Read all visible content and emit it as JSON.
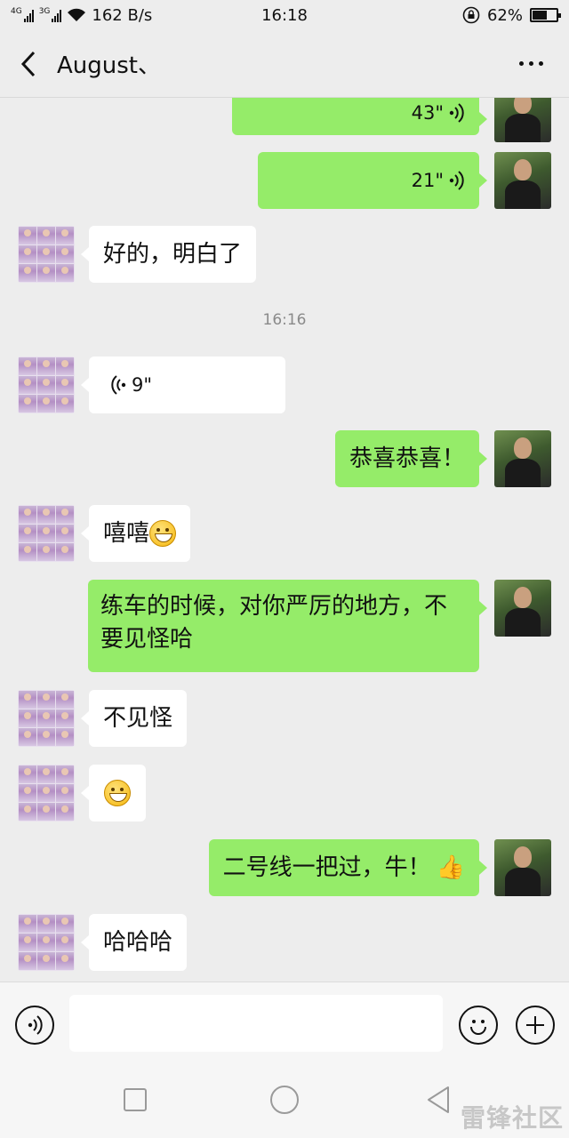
{
  "status_bar": {
    "net1": "4G",
    "net2": "3G",
    "speed": "162 B/s",
    "time": "16:18",
    "battery": "62%",
    "battery_level": 0.62
  },
  "header": {
    "title": "August、"
  },
  "messages": [
    {
      "side": "out",
      "type": "voice",
      "duration": "43\""
    },
    {
      "side": "out",
      "type": "voice",
      "duration": "21\""
    },
    {
      "side": "in",
      "type": "text",
      "text": "好的，明白了"
    },
    {
      "type": "timestamp",
      "text": "16:16"
    },
    {
      "side": "in",
      "type": "voice",
      "duration": "9\""
    },
    {
      "side": "out",
      "type": "text",
      "text": "恭喜恭喜！"
    },
    {
      "side": "in",
      "type": "text",
      "text": "嘻嘻",
      "emoji": "grin-emoji"
    },
    {
      "side": "out",
      "type": "text",
      "text": "练车的时候，对你严厉的地方，不要见怪哈"
    },
    {
      "side": "in",
      "type": "text",
      "text": "不见怪"
    },
    {
      "side": "in",
      "type": "emoji",
      "emoji": "grin-emoji"
    },
    {
      "side": "out",
      "type": "text",
      "text": "二号线一把过，牛！",
      "emoji": "thumbs-up-emoji"
    },
    {
      "side": "in",
      "type": "text",
      "text": "哈哈哈"
    }
  ],
  "input": {
    "placeholder": ""
  },
  "watermark": "雷锋社区"
}
